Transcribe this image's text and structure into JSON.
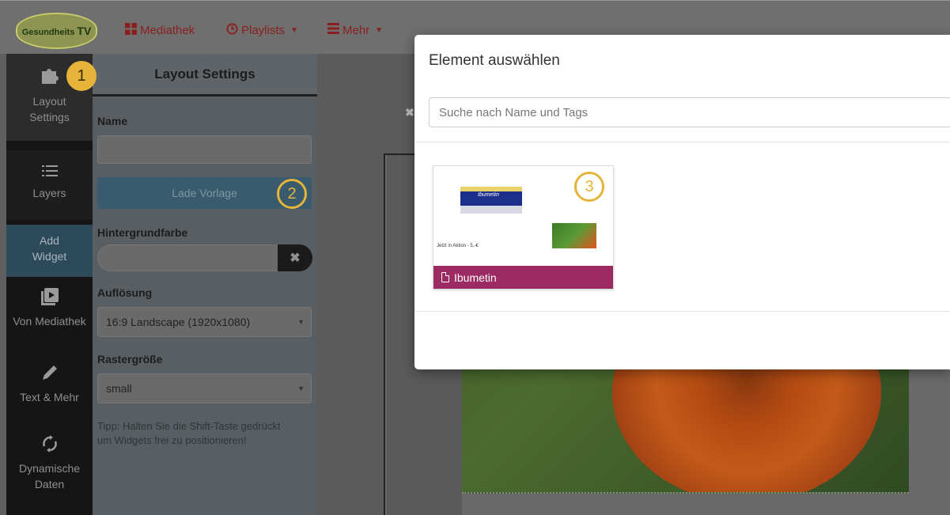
{
  "navbar": {
    "logo_text": "Gesundheits",
    "logo_tv": "TV",
    "mediathek_label": "Mediathek",
    "playlists_label": "Playlists",
    "mehr_label": "Mehr"
  },
  "sidebar": {
    "items": [
      {
        "label_line1": "Layout",
        "label_line2": "Settings"
      },
      {
        "label_line1": "Layers"
      },
      {
        "label_line1": "Add",
        "label_line2": "Widget"
      },
      {
        "label_line1": "Von Mediathek"
      },
      {
        "label_line1": "Text & Mehr"
      },
      {
        "label_line1": "Dynamische",
        "label_line2": "Daten"
      }
    ]
  },
  "panel": {
    "title": "Layout Settings",
    "name_label": "Name",
    "name_value": "",
    "vorlage_button": "Lade Vorlage",
    "bgcolor_label": "Hintergrundfarbe",
    "bgcolor_value": "",
    "resolution_label": "Auflösung",
    "resolution_value": "16:9 Landscape (1920x1080)",
    "grid_label": "Rastergröße",
    "grid_value": "small",
    "tip": "Tipp: Halten Sie die Shift-Taste gedrückt um Widgets frei zu positionieren!"
  },
  "markers": [
    "1",
    "2",
    "3"
  ],
  "modal": {
    "title": "Element auswählen",
    "search_placeholder": "Suche nach Name und Tags",
    "card": {
      "name": "Ibumetin",
      "pack_label": "Ibumetin",
      "thumb_caption": "Jetzt in Aktion - 5,-€"
    }
  },
  "colors": {
    "card_footer": "#9c2a63",
    "marker": "#e6b43a",
    "add_widget_bg": "#2d4a5a"
  }
}
